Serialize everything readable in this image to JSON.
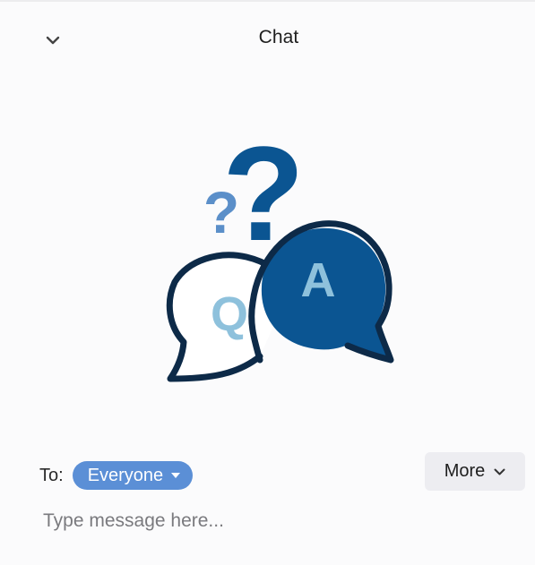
{
  "header": {
    "title": "Chat",
    "collapse_icon": "chevron-down-icon"
  },
  "illustration": {
    "icon": "qa-chat-bubbles-icon",
    "question_letter": "Q",
    "answer_letter": "A",
    "big_question_mark": "?",
    "small_question_mark": "?",
    "colors": {
      "dark_blue": "#0b5592",
      "light_blue": "#8ec1dc",
      "outline": "#0d2a48"
    }
  },
  "composer": {
    "to_label": "To:",
    "recipient": "Everyone",
    "recipient_color": "#5b8fd6",
    "more_label": "More",
    "message_placeholder": "Type message here...",
    "message_value": ""
  }
}
